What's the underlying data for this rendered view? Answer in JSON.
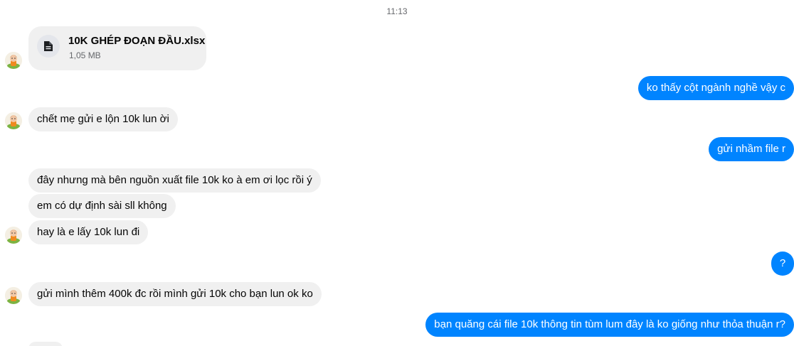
{
  "timestamp": "11:13",
  "file": {
    "icon": "document-icon",
    "name": "10K GHÉP ĐOẠN ĐẦU.xlsx",
    "size": "1,05 MB"
  },
  "messages": {
    "out_1": "ko thấy cột ngành nghề vậy c",
    "in_1": "chết mẹ gửi e lộn 10k lun ời",
    "out_2": "gửi nhầm file r",
    "in_2": "đây nhưng mà bên nguồn xuất file 10k ko à em ơi lọc rồi ý",
    "in_3": "em có dự định sài sll không",
    "in_4": "hay là e lấy 10k lun đi",
    "out_3": "?",
    "in_5": "gửi mình thêm 400k đc rồi mình gửi 10k cho bạn lun ok ko",
    "out_4": "bạn quăng cái file 10k thông tin tùm lum đây là ko giống như thỏa thuận r?"
  },
  "colors": {
    "outgoing_bubble": "#0084ff",
    "incoming_bubble": "#f0f0f0",
    "meta_text": "#65676b"
  }
}
